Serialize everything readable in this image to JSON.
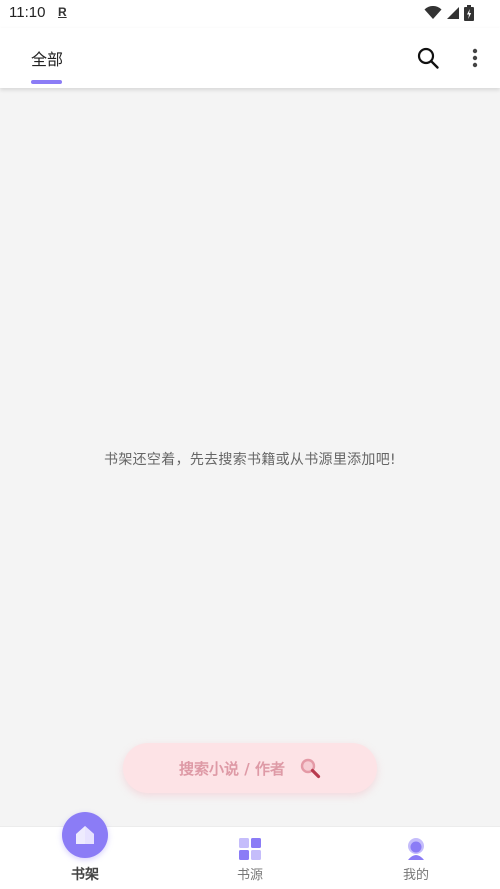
{
  "status_bar": {
    "time": "11:10",
    "r_indicator": "R"
  },
  "header": {
    "tab_all_label": "全部"
  },
  "empty_state": {
    "message": "书架还空着，先去搜索书籍或从书源里添加吧!"
  },
  "search_pill": {
    "label": "搜索小说 / 作者"
  },
  "bottom_nav": {
    "items": [
      {
        "label": "书架",
        "icon": "home-icon",
        "active": true
      },
      {
        "label": "书源",
        "icon": "grid-icon",
        "active": false
      },
      {
        "label": "我的",
        "icon": "profile-icon",
        "active": false
      }
    ]
  },
  "colors": {
    "accent": "#8b7cf6",
    "pill_bg": "#fde3e6",
    "pill_text": "#de9aa6",
    "background": "#f4f4f4"
  }
}
